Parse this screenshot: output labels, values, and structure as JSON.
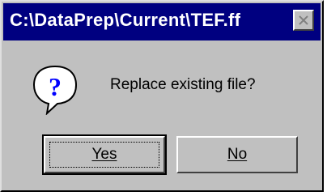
{
  "window": {
    "title": "C:\\DataPrep\\Current\\TEF.ff",
    "close_icon": "close-icon"
  },
  "dialog": {
    "icon": "question-mark-icon",
    "message": "Replace existing file?"
  },
  "buttons": {
    "yes_label": "Yes",
    "no_label": "No"
  },
  "colors": {
    "titlebar": "#000080",
    "face": "#c0c0c0",
    "icon_fill": "#0000ff"
  }
}
